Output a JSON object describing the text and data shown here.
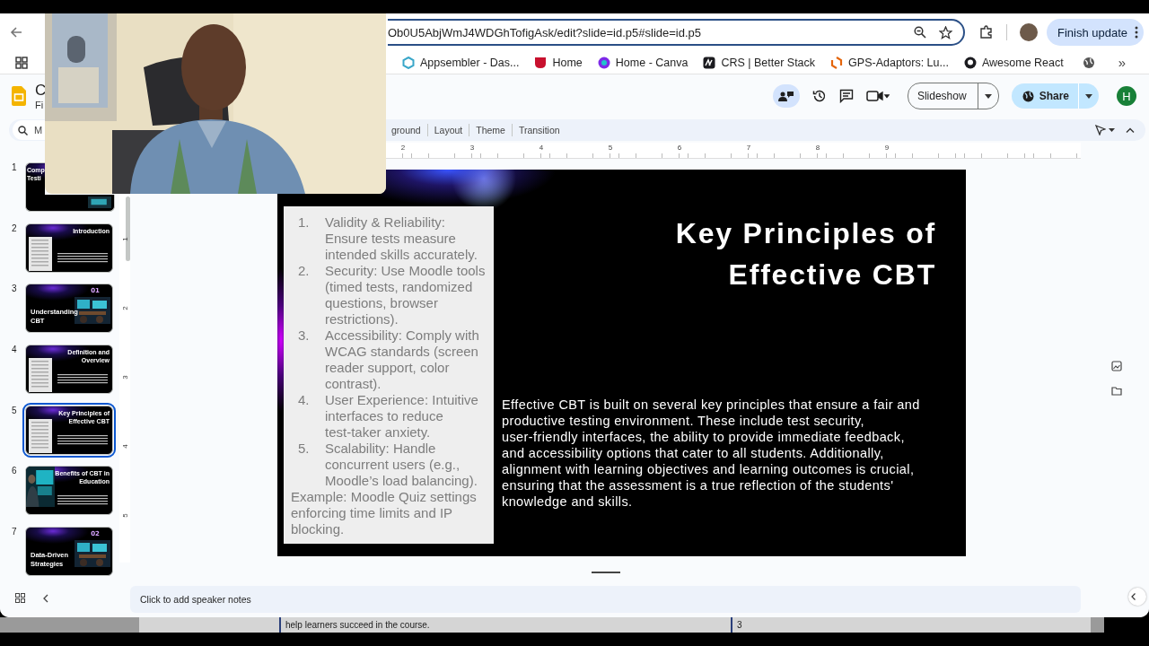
{
  "browser": {
    "url": "Ob0U5AbjWmJ4WDGhTofigAsk/edit?slide=id.p5#slide=id.p5",
    "update_button": "Finish update",
    "bookmarks": [
      {
        "label": "Appsembler - Das...",
        "kind": "hexagon"
      },
      {
        "label": "Home",
        "kind": "shield"
      },
      {
        "label": "Home - Canva",
        "kind": "circle"
      },
      {
        "label": "CRS | Better Stack",
        "kind": "square"
      },
      {
        "label": "GPS-Adaptors: Lu...",
        "kind": "brackets"
      },
      {
        "label": "Awesome React",
        "kind": "octocat"
      }
    ],
    "more_bookmarks": "»"
  },
  "app": {
    "title": "C",
    "menu": "Fi",
    "slideshow_button": "Slideshow",
    "share_button": "Share",
    "avatar": "H"
  },
  "toolbar": {
    "search_placeholder": "M",
    "items": [
      "ground",
      "Layout",
      "Theme",
      "Transition"
    ]
  },
  "ruler": {
    "marks": [
      "2",
      "3",
      "4",
      "5",
      "6",
      "7",
      "8",
      "9"
    ],
    "vertical_marks": [
      "1",
      "2",
      "3",
      "4",
      "5"
    ]
  },
  "filmstrip": [
    {
      "number": "1",
      "kind": "title",
      "title": "Comp Testi",
      "selected": false
    },
    {
      "number": "2",
      "kind": "text-panel",
      "title": "Introduction",
      "selected": false
    },
    {
      "number": "3",
      "kind": "section",
      "title": "Understanding CBT",
      "badge": "01",
      "selected": false
    },
    {
      "number": "4",
      "kind": "text-panel",
      "title": "Definition and Overview",
      "selected": false
    },
    {
      "number": "5",
      "kind": "text-panel",
      "title": "Key Principles of Effective CBT",
      "selected": true
    },
    {
      "number": "6",
      "kind": "image-left",
      "title": "Benefits of CBT in Education",
      "selected": false
    },
    {
      "number": "7",
      "kind": "section",
      "title": "Data-Driven Strategies",
      "badge": "02",
      "selected": false
    }
  ],
  "slide": {
    "title_lines": [
      "Key Principles of",
      "Effective CBT"
    ],
    "list": [
      {
        "number": "1.",
        "text": "Validity & Reliability: Ensure tests measure intended skills accurately."
      },
      {
        "number": "2.",
        "text": "Security: Use Moodle tools (timed tests, randomized questions, browser restrictions)."
      },
      {
        "number": "3.",
        "text": "Accessibility: Comply with WCAG standards (screen reader support, color contrast)."
      },
      {
        "number": "4.",
        "text": "User Experience: Intuitive interfaces to reduce test-taker anxiety."
      },
      {
        "number": "5.",
        "text": "Scalability: Handle concurrent users (e.g., Moodle’s load balancing)."
      }
    ],
    "example": "Example: Moodle Quiz settings enforcing time limits and IP blocking.",
    "body": "Effective CBT is built on several key principles that ensure a fair and productive testing environment. These include test security, user-friendly interfaces, the ability to provide immediate feedback, and accessibility options that cater to all students. Additionally, alignment with learning objectives and learning outcomes is crucial, ensuring that the assessment is a true reflection of the students' knowledge and skills."
  },
  "notes": {
    "placeholder": "Click to add speaker notes"
  },
  "background_window": {
    "text": "help learners succeed in the course.",
    "page": "3"
  }
}
